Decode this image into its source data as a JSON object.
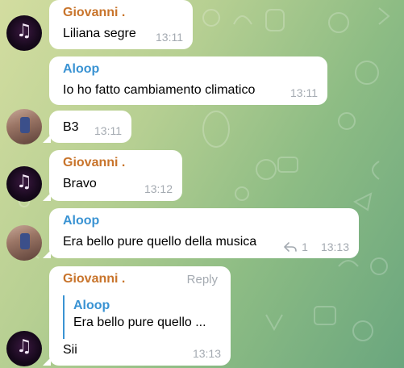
{
  "messages": [
    {
      "sender": "Giovanni .",
      "text": "Liliana segre",
      "time": "13:11"
    },
    {
      "sender": "Aloop",
      "text": "Io ho fatto cambiamento climatico",
      "time": "13:11"
    },
    {
      "text": "B3",
      "time": "13:11"
    },
    {
      "sender": "Giovanni .",
      "text": "Bravo",
      "time": "13:12"
    },
    {
      "sender": "Aloop",
      "text": "Era bello pure quello della musica",
      "replies": "1",
      "time": "13:13"
    },
    {
      "sender": "Giovanni .",
      "reply_label": "Reply",
      "quote": {
        "sender": "Aloop",
        "text": "Era bello pure quello ..."
      },
      "text": "Sii",
      "time": "13:13"
    }
  ],
  "colors": {
    "giovanni": "#c8742b",
    "aloop": "#3a93d3",
    "time": "#a4aab1"
  },
  "icons": {
    "reply_count": "reply-arrow-icon",
    "avatar_music": "music-note-icon",
    "avatar_photo": "profile-photo"
  }
}
